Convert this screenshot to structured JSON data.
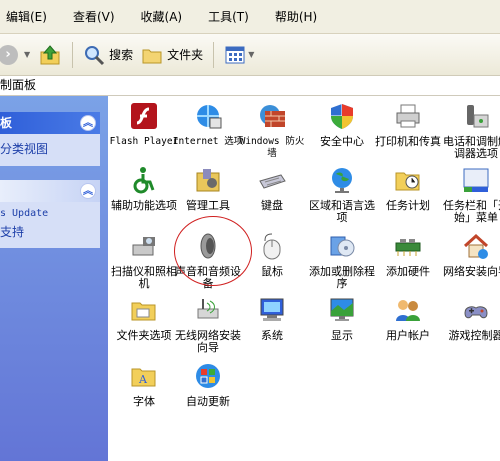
{
  "menu": [
    "编辑(E)",
    "查看(V)",
    "收藏(A)",
    "工具(T)",
    "帮助(H)"
  ],
  "toolbar": {
    "search": "搜索",
    "folders": "文件夹"
  },
  "address": "制面板",
  "left": {
    "panel1_title": "板",
    "panel1_link": "分类视图",
    "panel2_line1": "s Update",
    "panel2_line2": "支持"
  },
  "items": [
    {
      "label": "Flash Player",
      "icon": "flash-icon"
    },
    {
      "label": "Internet 选项",
      "icon": "internet-options-icon"
    },
    {
      "label": "Windows 防火墙",
      "icon": "firewall-icon"
    },
    {
      "label": "安全中心",
      "icon": "security-center-icon"
    },
    {
      "label": "打印机和传真",
      "icon": "printer-icon"
    },
    {
      "label": "电话和调制解调器选项",
      "icon": "phone-modem-icon"
    },
    {
      "label": "辅助功能选项",
      "icon": "accessibility-icon"
    },
    {
      "label": "管理工具",
      "icon": "admin-tools-icon"
    },
    {
      "label": "键盘",
      "icon": "keyboard-icon"
    },
    {
      "label": "区域和语言选项",
      "icon": "region-language-icon"
    },
    {
      "label": "任务计划",
      "icon": "scheduled-tasks-icon"
    },
    {
      "label": "任务栏和「开始」菜单",
      "icon": "taskbar-start-icon"
    },
    {
      "label": "扫描仪和照相机",
      "icon": "scanner-camera-icon"
    },
    {
      "label": "声音和音频设备",
      "icon": "sound-audio-icon"
    },
    {
      "label": "鼠标",
      "icon": "mouse-icon"
    },
    {
      "label": "添加或删除程序",
      "icon": "add-remove-programs-icon"
    },
    {
      "label": "添加硬件",
      "icon": "add-hardware-icon"
    },
    {
      "label": "网络安装向导",
      "icon": "network-setup-icon"
    },
    {
      "label": "文件夹选项",
      "icon": "folder-options-icon"
    },
    {
      "label": "无线网络安装向导",
      "icon": "wireless-setup-icon"
    },
    {
      "label": "系统",
      "icon": "system-icon"
    },
    {
      "label": "显示",
      "icon": "display-icon"
    },
    {
      "label": "用户帐户",
      "icon": "user-accounts-icon"
    },
    {
      "label": "游戏控制器",
      "icon": "game-controller-icon"
    },
    {
      "label": "字体",
      "icon": "fonts-icon"
    },
    {
      "label": "自动更新",
      "icon": "automatic-updates-icon"
    }
  ]
}
